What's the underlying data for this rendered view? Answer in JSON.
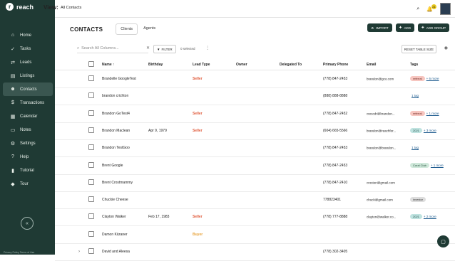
{
  "app": {
    "logo_text": "reach",
    "view_label": "View:",
    "view_value": "All Contacts"
  },
  "topbar": {
    "bell_badge": "21"
  },
  "sidebar": {
    "items": [
      {
        "label": "Home",
        "icon": "home-icon",
        "glyph": "⌂"
      },
      {
        "label": "Tasks",
        "icon": "tasks-icon",
        "glyph": "✓"
      },
      {
        "label": "Leads",
        "icon": "leads-icon",
        "glyph": "⇄"
      },
      {
        "label": "Listings",
        "icon": "listings-icon",
        "glyph": "▤"
      },
      {
        "label": "Contacts",
        "icon": "contacts-icon",
        "glyph": "☻"
      },
      {
        "label": "Transactions",
        "icon": "transactions-icon",
        "glyph": "$"
      },
      {
        "label": "Calendar",
        "icon": "calendar-icon",
        "glyph": "▦"
      },
      {
        "label": "Notes",
        "icon": "notes-icon",
        "glyph": "▭"
      },
      {
        "label": "Settings",
        "icon": "settings-icon",
        "glyph": "⚙"
      },
      {
        "label": "Help",
        "icon": "help-icon",
        "glyph": "?"
      },
      {
        "label": "Tutorial",
        "icon": "tutorial-icon",
        "glyph": "▮"
      },
      {
        "label": "Tour",
        "icon": "tour-icon",
        "glyph": "◆"
      }
    ],
    "collapse_glyph": "«",
    "footer": "Privacy Policy   Terms of Use"
  },
  "page": {
    "title": "CONTACTS",
    "tabs": [
      "Clients",
      "Agents"
    ],
    "actions": [
      "IMPORT",
      "ADD",
      "ADD GROUP"
    ]
  },
  "toolbar": {
    "search_placeholder": "Search All Columns...",
    "filter_label": "FILTER",
    "selected_text": "0 selected",
    "reset_label": "RESET TABLE SIZE"
  },
  "table": {
    "headers": [
      "Name ↑",
      "Birthday",
      "Lead Type",
      "Owner",
      "Delegated To",
      "Primary Phone",
      "Email",
      "Tags"
    ],
    "rows": [
      {
        "name": "Brandelle GoogleTest",
        "birthday": "",
        "lead": "Seller",
        "phone": "(778) 847-2453",
        "email": "brandon@gco.com",
        "tag": "referral",
        "tagclass": "tag-referral",
        "more": "+ 6 more"
      },
      {
        "name": "brandon crichton",
        "birthday": "",
        "lead": "",
        "phone": "(888) 888-8888",
        "email": "",
        "tag": "",
        "tagclass": "",
        "more": "1 tag"
      },
      {
        "name": "Brandon GoTest4",
        "birthday": "",
        "lead": "Seller",
        "phone": "(778) 847-2452",
        "email": "crescdr@brandon...",
        "tag": "referral",
        "tagclass": "tag-referral",
        "more": "+ 1 more"
      },
      {
        "name": "Brandon Maclean",
        "birthday": "Apr 9, 1979",
        "lead": "Seller",
        "phone": "(604) 665-5566",
        "email": "brandon@reachfor...",
        "tag": "2021",
        "tagclass": "tag-2021",
        "more": "+ 3 more"
      },
      {
        "name": "Brandon TestGoo",
        "birthday": "",
        "lead": "",
        "phone": "(778) 847-2453",
        "email": "brandon@brandon...",
        "tag": "",
        "tagclass": "",
        "more": "1 tag"
      },
      {
        "name": "Brent Google",
        "birthday": "",
        "lead": "",
        "phone": "(778) 847-2453",
        "email": "",
        "tag": "Coral Club",
        "tagclass": "tag-cora",
        "more": "+ 1 more"
      },
      {
        "name": "Brent Crostmammy",
        "birthday": "",
        "lead": "",
        "phone": "(778) 847-2410",
        "email": "croston@gmail.com",
        "tag": "",
        "tagclass": "",
        "more": ""
      },
      {
        "name": "Chuckie Cheese",
        "birthday": "",
        "lead": "",
        "phone": "778823401",
        "email": "chuck@gmail.com",
        "tag": "investor",
        "tagclass": "tag-investor",
        "more": ""
      },
      {
        "name": "Clayton Walker",
        "birthday": "Feb 17, 1983",
        "lead": "Seller",
        "phone": "(778) 777-8888",
        "email": "clayton@walker.co...",
        "tag": "2021",
        "tagclass": "tag-2021",
        "more": "+ 2 more"
      },
      {
        "name": "Damon Kiizaner",
        "birthday": "",
        "lead": "Buyer",
        "phone": "",
        "email": "",
        "tag": "",
        "tagclass": "",
        "more": ""
      },
      {
        "name": "David and Aleesa",
        "birthday": "",
        "lead": "",
        "phone": "(778) 302-3405",
        "email": "",
        "tag": "",
        "tagclass": "",
        "more": ""
      }
    ]
  }
}
